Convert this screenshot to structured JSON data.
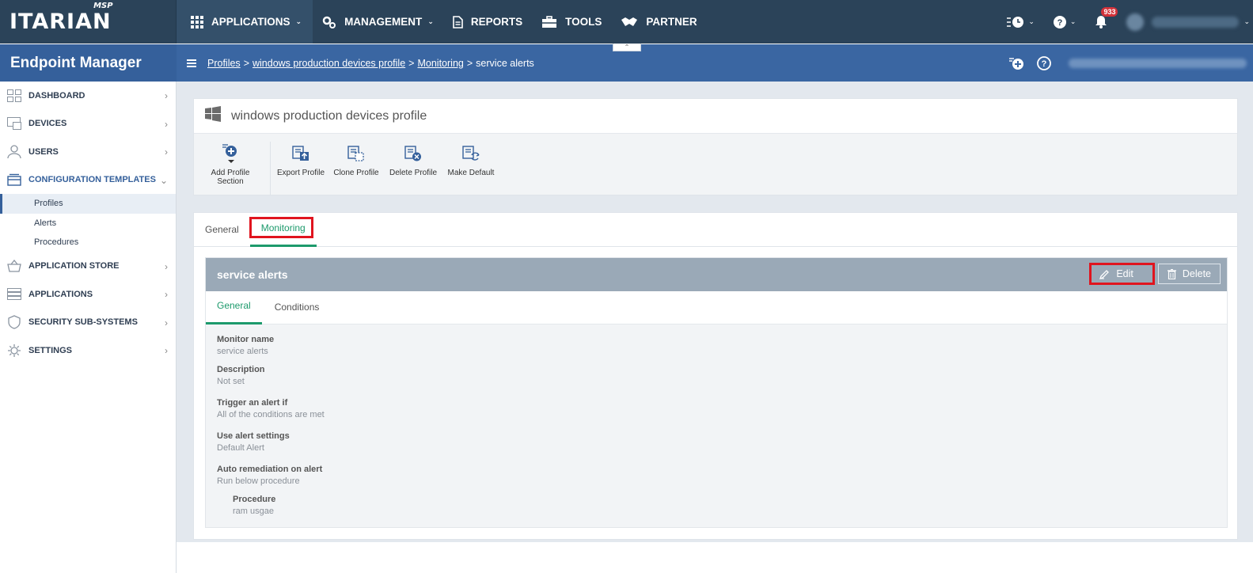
{
  "app": {
    "logo": "ITARIAN",
    "logo_tag": "MSP",
    "section_title": "Endpoint Manager"
  },
  "topnav": {
    "items": [
      {
        "label": "APPLICATIONS",
        "icon": "grid-icon",
        "has_caret": true
      },
      {
        "label": "MANAGEMENT",
        "icon": "gears-icon",
        "has_caret": true
      },
      {
        "label": "REPORTS",
        "icon": "document-icon",
        "has_caret": false
      },
      {
        "label": "TOOLS",
        "icon": "toolbox-icon",
        "has_caret": false
      },
      {
        "label": "PARTNER",
        "icon": "handshake-icon",
        "has_caret": false
      }
    ],
    "notification_count": "933"
  },
  "breadcrumb": {
    "items": [
      "Profiles",
      "windows production devices profile",
      "Monitoring"
    ],
    "current": "service alerts"
  },
  "sidebar": {
    "items": [
      {
        "label": "DASHBOARD",
        "icon": "dashboard-icon"
      },
      {
        "label": "DEVICES",
        "icon": "devices-icon"
      },
      {
        "label": "USERS",
        "icon": "user-icon"
      },
      {
        "label": "CONFIGURATION TEMPLATES",
        "icon": "templates-icon"
      },
      {
        "label": "APPLICATION STORE",
        "icon": "basket-icon"
      },
      {
        "label": "APPLICATIONS",
        "icon": "servers-icon"
      },
      {
        "label": "SECURITY SUB-SYSTEMS",
        "icon": "shield-icon"
      },
      {
        "label": "SETTINGS",
        "icon": "gear-icon"
      }
    ],
    "sub_items": [
      "Profiles",
      "Alerts",
      "Procedures"
    ]
  },
  "profile": {
    "title": "windows production devices profile",
    "toolbar": [
      {
        "label": "Add Profile Section",
        "icon": "add-section-icon"
      },
      {
        "label": "Export Profile",
        "icon": "export-icon"
      },
      {
        "label": "Clone Profile",
        "icon": "clone-icon"
      },
      {
        "label": "Delete Profile",
        "icon": "delete-profile-icon"
      },
      {
        "label": "Make Default",
        "icon": "make-default-icon"
      }
    ],
    "add_label_line1": "Add Profile",
    "add_label_line2": "Section"
  },
  "tabs": [
    "General",
    "Monitoring"
  ],
  "monitor": {
    "title": "service alerts",
    "edit_label": "Edit",
    "delete_label": "Delete",
    "subtabs": [
      "General",
      "Conditions"
    ],
    "fields": [
      {
        "label": "Monitor name",
        "value": "service alerts"
      },
      {
        "label": "Description",
        "value": "Not set"
      },
      {
        "label": "Trigger an alert if",
        "value": "All of the conditions are met"
      },
      {
        "label": "Use alert settings",
        "value": "Default Alert"
      },
      {
        "label": "Auto remediation on alert",
        "value": "Run below procedure"
      },
      {
        "label": "Procedure",
        "value": "ram usgae"
      }
    ]
  },
  "colors": {
    "topbar": "#2b4359",
    "subbar": "#3a66a2",
    "accent_green": "#1d9a6c",
    "highlight_red": "#e0141e",
    "panel_header": "#9aa9b7"
  }
}
